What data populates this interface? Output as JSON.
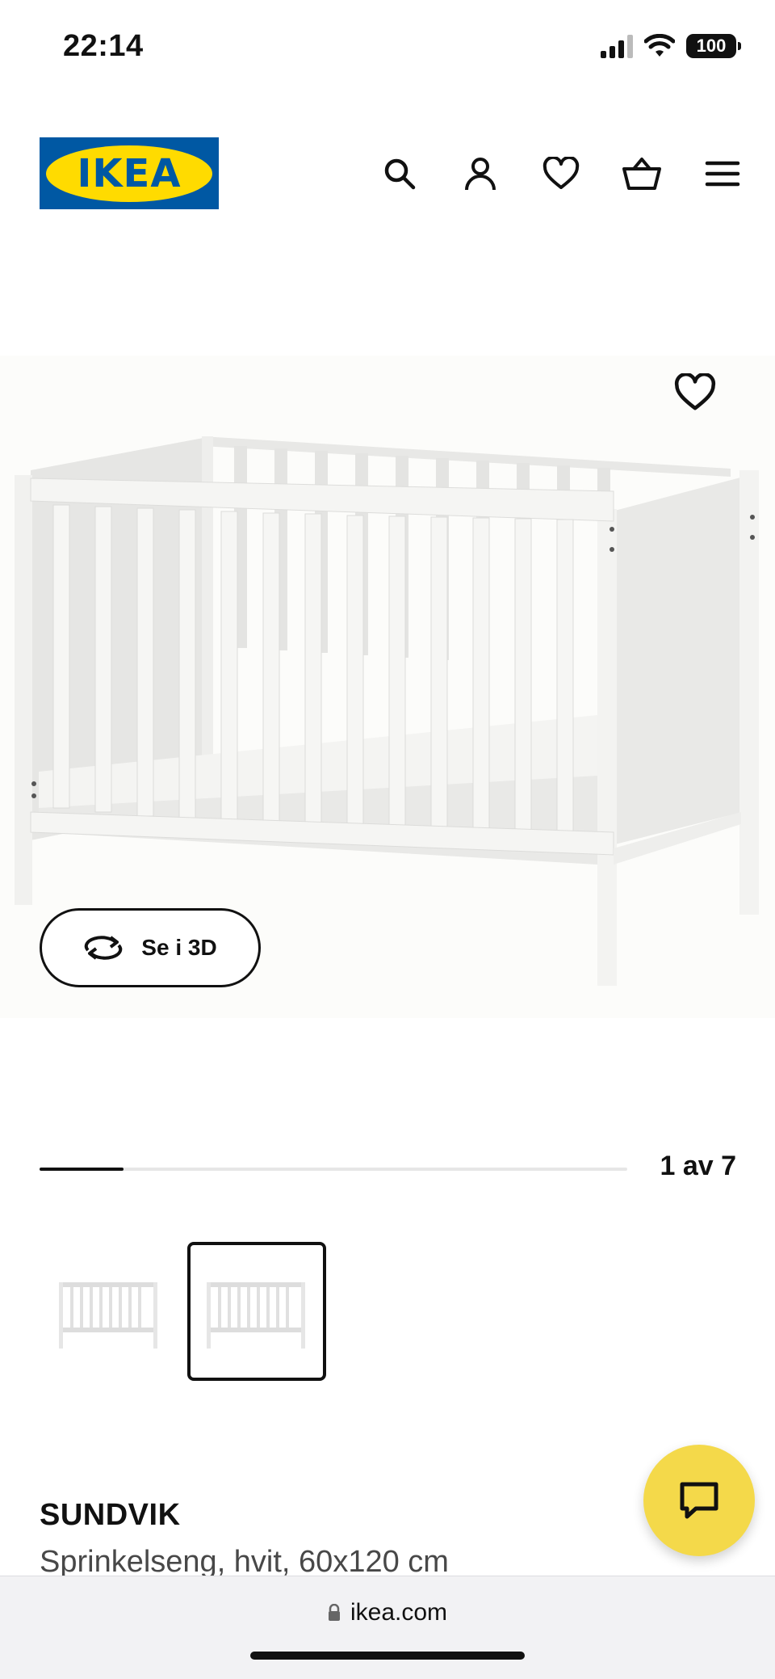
{
  "status_bar": {
    "time": "22:14",
    "battery": "100"
  },
  "header": {
    "logo_text": "IKEA"
  },
  "icons": {
    "search": "search-icon",
    "account": "person-icon",
    "wishlist": "heart-icon",
    "cart": "basket-icon",
    "menu": "hamburger-menu-icon",
    "rotate": "rotate-3d-icon",
    "chat": "chat-bubble-icon",
    "lock": "lock-icon"
  },
  "gallery": {
    "view_3d_label": "Se i 3D",
    "position_text": "1 av 7",
    "progress": 0.143
  },
  "product": {
    "name": "SUNDVIK",
    "description": "Sprinkelseng, hvit, 60x120 cm"
  },
  "browser": {
    "url": "ikea.com"
  },
  "colors": {
    "ikea_blue": "#0058a3",
    "ikea_yellow": "#ffdb00",
    "chat_yellow": "#f4d94a"
  }
}
